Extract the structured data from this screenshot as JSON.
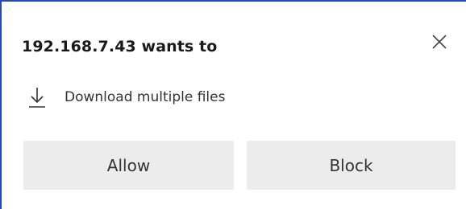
{
  "dialog": {
    "title": "192.168.7.43 wants to",
    "close_icon": "close-icon",
    "request": {
      "icon": "download-icon",
      "text": "Download multiple files"
    },
    "buttons": {
      "allow_label": "Allow",
      "block_label": "Block"
    }
  },
  "colors": {
    "accent_border": "#2b4aa8",
    "button_bg": "#ececec",
    "text": "#333333",
    "title_text": "#1a1a1a",
    "background": "#ffffff"
  }
}
